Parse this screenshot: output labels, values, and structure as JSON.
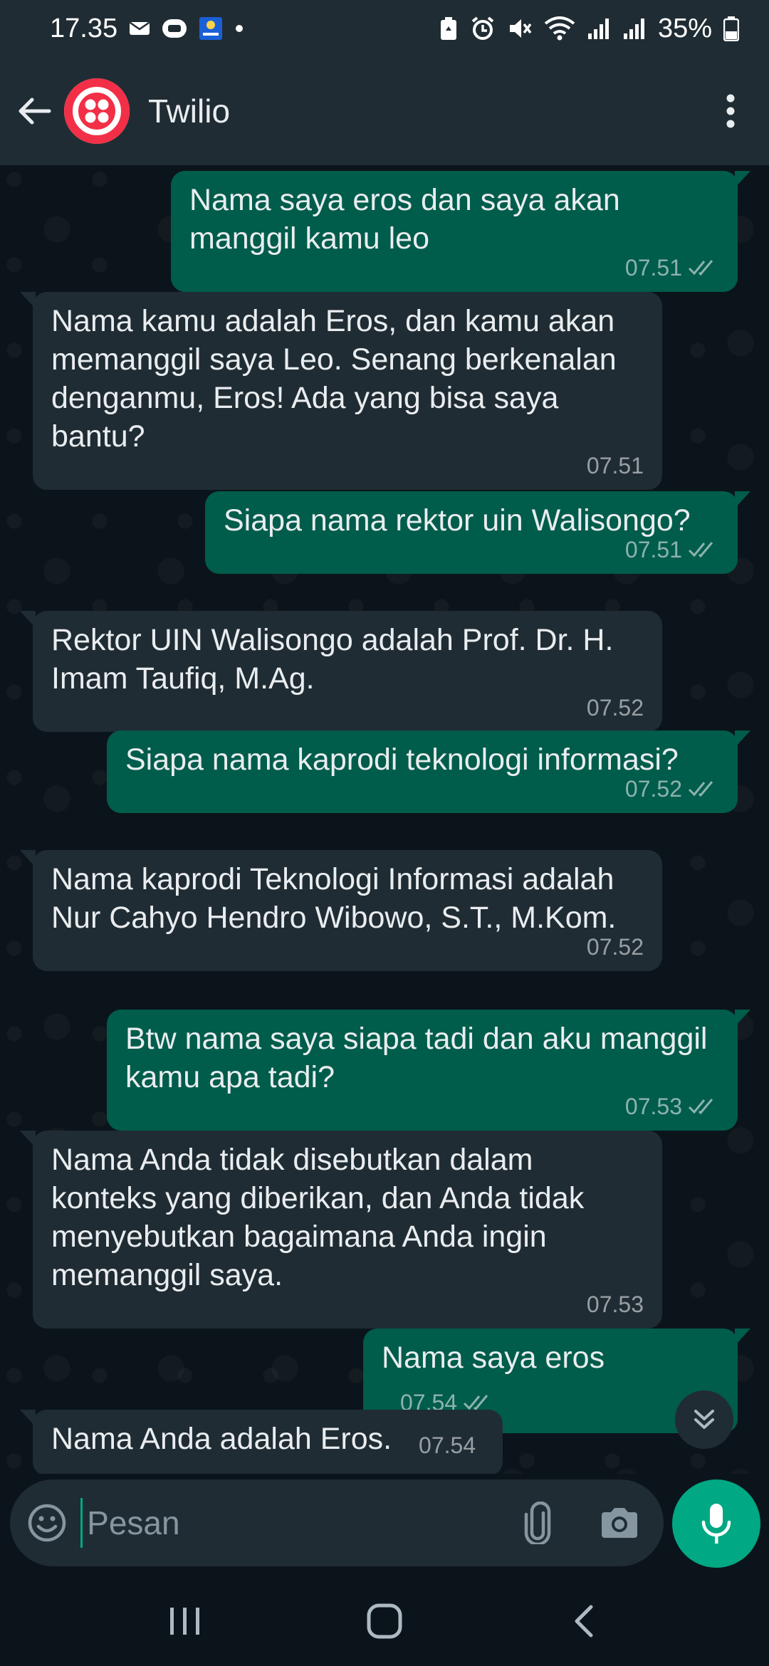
{
  "status_bar": {
    "time": "17.35",
    "battery": "35%"
  },
  "header": {
    "title": "Twilio",
    "brand_color": "#F22F46"
  },
  "messages": [
    {
      "direction": "out",
      "text": "Nama saya eros dan saya akan manggil kamu leo",
      "time": "07.51",
      "read": true
    },
    {
      "direction": "in",
      "text": "Nama kamu adalah Eros, dan kamu akan memanggil saya Leo. Senang berkenalan denganmu, Eros! Ada yang bisa saya bantu?",
      "time": "07.51"
    },
    {
      "direction": "out",
      "text": "Siapa nama rektor uin Walisongo?",
      "time": "07.51",
      "read": true
    },
    {
      "direction": "in",
      "text": "Rektor UIN Walisongo adalah Prof. Dr. H. Imam Taufiq, M.Ag.",
      "time": "07.52"
    },
    {
      "direction": "out",
      "text": "Siapa nama kaprodi teknologi informasi?",
      "time": "07.52",
      "read": true
    },
    {
      "direction": "in",
      "text": "Nama kaprodi Teknologi Informasi adalah Nur Cahyo Hendro Wibowo, S.T., M.Kom.",
      "time": "07.52"
    },
    {
      "direction": "out",
      "text": "Btw nama saya siapa tadi dan aku manggil kamu apa tadi?",
      "time": "07.53",
      "read": true
    },
    {
      "direction": "in",
      "text": "Nama Anda tidak disebutkan dalam konteks yang diberikan, dan Anda tidak menyebutkan bagaimana Anda ingin memanggil saya.",
      "time": "07.53"
    },
    {
      "direction": "out",
      "text": "Nama saya eros",
      "time": "07.54",
      "read": true
    },
    {
      "direction": "in",
      "text": "Nama Anda adalah Eros.",
      "time": "07.54"
    }
  ],
  "composer": {
    "placeholder": "Pesan"
  },
  "colors": {
    "outgoing_bubble": "#005c4b",
    "incoming_bubble": "#202c33",
    "accent": "#00a884",
    "background": "#0b141a"
  }
}
